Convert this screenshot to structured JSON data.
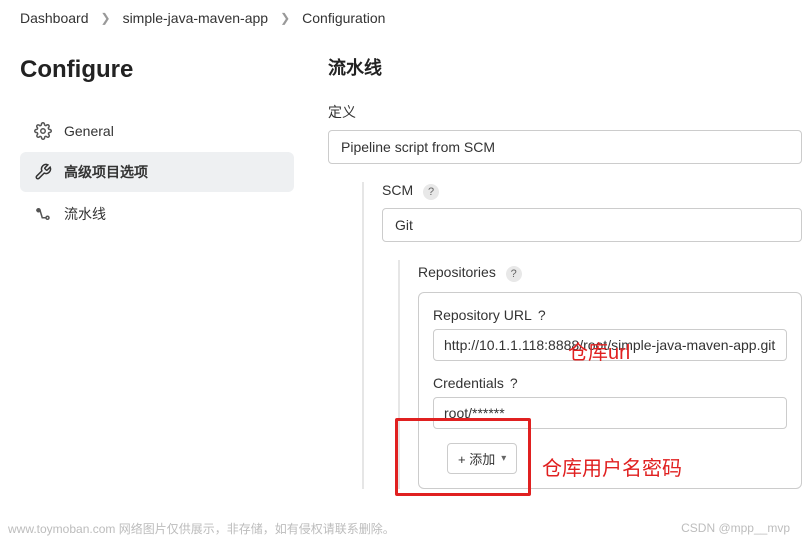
{
  "breadcrumb": {
    "items": [
      "Dashboard",
      "simple-java-maven-app",
      "Configuration"
    ]
  },
  "sidebar": {
    "title": "Configure",
    "items": [
      {
        "label": "General"
      },
      {
        "label": "高级项目选项"
      },
      {
        "label": "流水线"
      }
    ]
  },
  "main": {
    "title": "流水线",
    "definition_label": "定义",
    "definition_value": "Pipeline script from SCM",
    "scm_label": "SCM",
    "scm_value": "Git",
    "repositories_label": "Repositories",
    "repo_url_label": "Repository URL",
    "repo_url_value": "http://10.1.1.118:8888/root/simple-java-maven-app.git",
    "credentials_label": "Credentials",
    "credentials_value": "root/******",
    "add_button": "+ 添加"
  },
  "annotations": {
    "url_note": "仓库url",
    "cred_note": "仓库用户名密码"
  },
  "watermark": {
    "left": "www.toymoban.com 网络图片仅供展示，非存储，如有侵权请联系删除。",
    "right": "CSDN @mpp__mvp"
  }
}
